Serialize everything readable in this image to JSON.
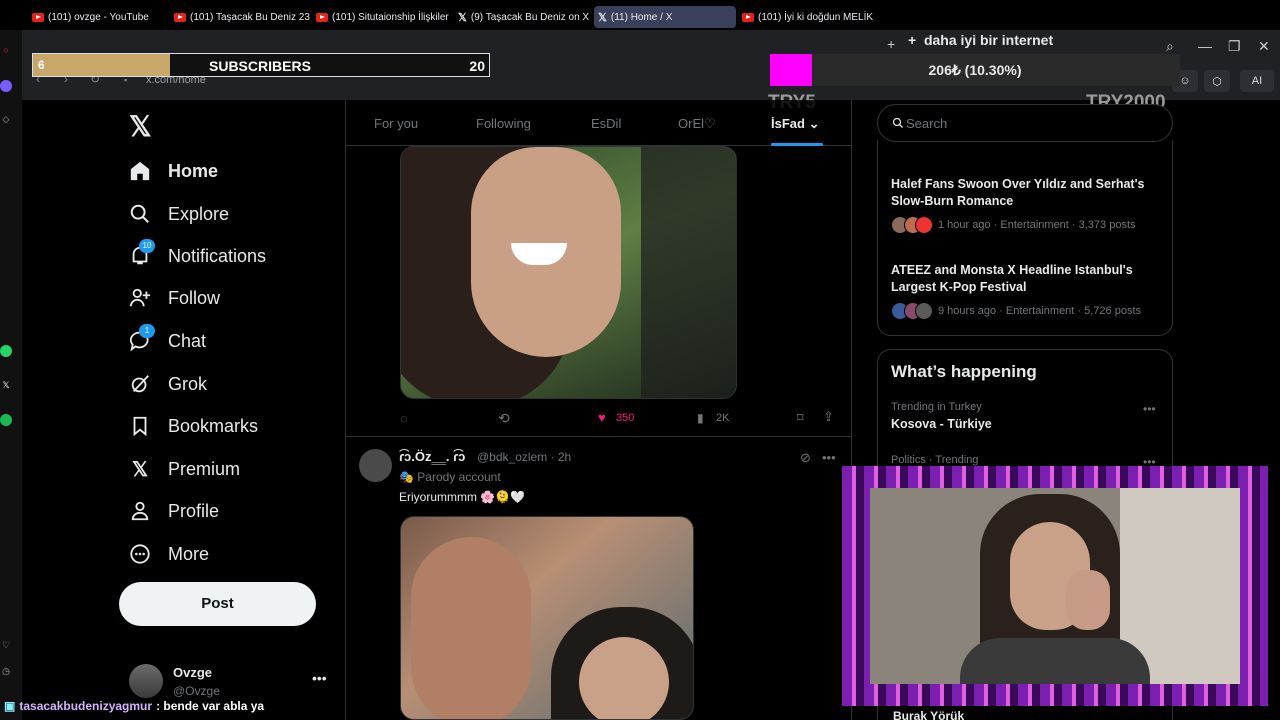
{
  "browser": {
    "tabs": [
      {
        "title": "(101) ovzge - YouTube",
        "icon": "youtube-icon"
      },
      {
        "title": "(101) Taşacak Bu Deniz 23",
        "icon": "youtube-icon"
      },
      {
        "title": "(101) Situtaionship İlişkiler",
        "icon": "youtube-icon"
      },
      {
        "title": "(9) Taşacak Bu Deniz on X",
        "icon": "x-icon"
      },
      {
        "title": "(11) Home / X",
        "icon": "x-icon"
      },
      {
        "title": "(101) İyi ki doğdun MELİK",
        "icon": "youtube-icon"
      }
    ],
    "url": "x.com/home",
    "ext_ai": "AI"
  },
  "stream": {
    "sub_goal": {
      "current": "6",
      "label": "SUBSCRIBERS",
      "target": "20",
      "progress": 0.3
    },
    "donation_goal": {
      "title": "daha iyi bir internet",
      "amount": "206₺ (10.30%)",
      "min": "TRY5",
      "max": "TRY2000",
      "progress": 0.103
    },
    "chat": {
      "user": "tasacakbudenizyagmur",
      "message": ": bende var abla ya"
    }
  },
  "x_nav": {
    "items": [
      {
        "label": "Home",
        "name": "home",
        "badge": ""
      },
      {
        "label": "Explore",
        "name": "explore",
        "badge": ""
      },
      {
        "label": "Notifications",
        "name": "notifications",
        "badge": "10"
      },
      {
        "label": "Follow",
        "name": "follow",
        "badge": ""
      },
      {
        "label": "Chat",
        "name": "chat",
        "badge": "1"
      },
      {
        "label": "Grok",
        "name": "grok",
        "badge": ""
      },
      {
        "label": "Bookmarks",
        "name": "bookmarks",
        "badge": ""
      },
      {
        "label": "Premium",
        "name": "premium",
        "badge": ""
      },
      {
        "label": "Profile",
        "name": "profile",
        "badge": ""
      },
      {
        "label": "More",
        "name": "more",
        "badge": ""
      }
    ],
    "post_label": "Post",
    "account": {
      "name": "Ovzge",
      "handle": "@Ovzge"
    }
  },
  "timeline": {
    "tabs": [
      "For you",
      "Following",
      "EsDil",
      "OrEl♡",
      "İsFad"
    ],
    "selected_tab": "İsFad",
    "post1": {
      "likes": "350",
      "views": "2K"
    },
    "post2": {
      "name": "ɾ͡ɔ.Öz‗‗. ɾ͡ɔ",
      "handle": "@bdk_ozlem · 2h",
      "parody": "Parody account",
      "text": "Eriyorummmm 🌸🫠🤍"
    }
  },
  "sidebar": {
    "search_placeholder": "Search",
    "news": [
      {
        "title": "Halef Fans Swoon Over Yıldız and Serhat's Slow-Burn Romance",
        "meta": "1 hour ago · Entertainment · 3,373 posts"
      },
      {
        "title": "ATEEZ and Monsta X Headline Istanbul's Largest K-Pop Festival",
        "meta": "9 hours ago · Entertainment · 5,726 posts"
      }
    ],
    "whats_happening": "What’s happening",
    "trends": [
      {
        "context": "Trending in Turkey",
        "name": "Kosova - Türkiye"
      },
      {
        "context": "Politics · Trending",
        "name": ""
      }
    ],
    "below_cam": "Burak Yörük"
  },
  "colors": {
    "accent": "#1d9bf0",
    "like": "#f91880",
    "goal": "#ff00ff",
    "sub_fill": "#c8a868"
  }
}
